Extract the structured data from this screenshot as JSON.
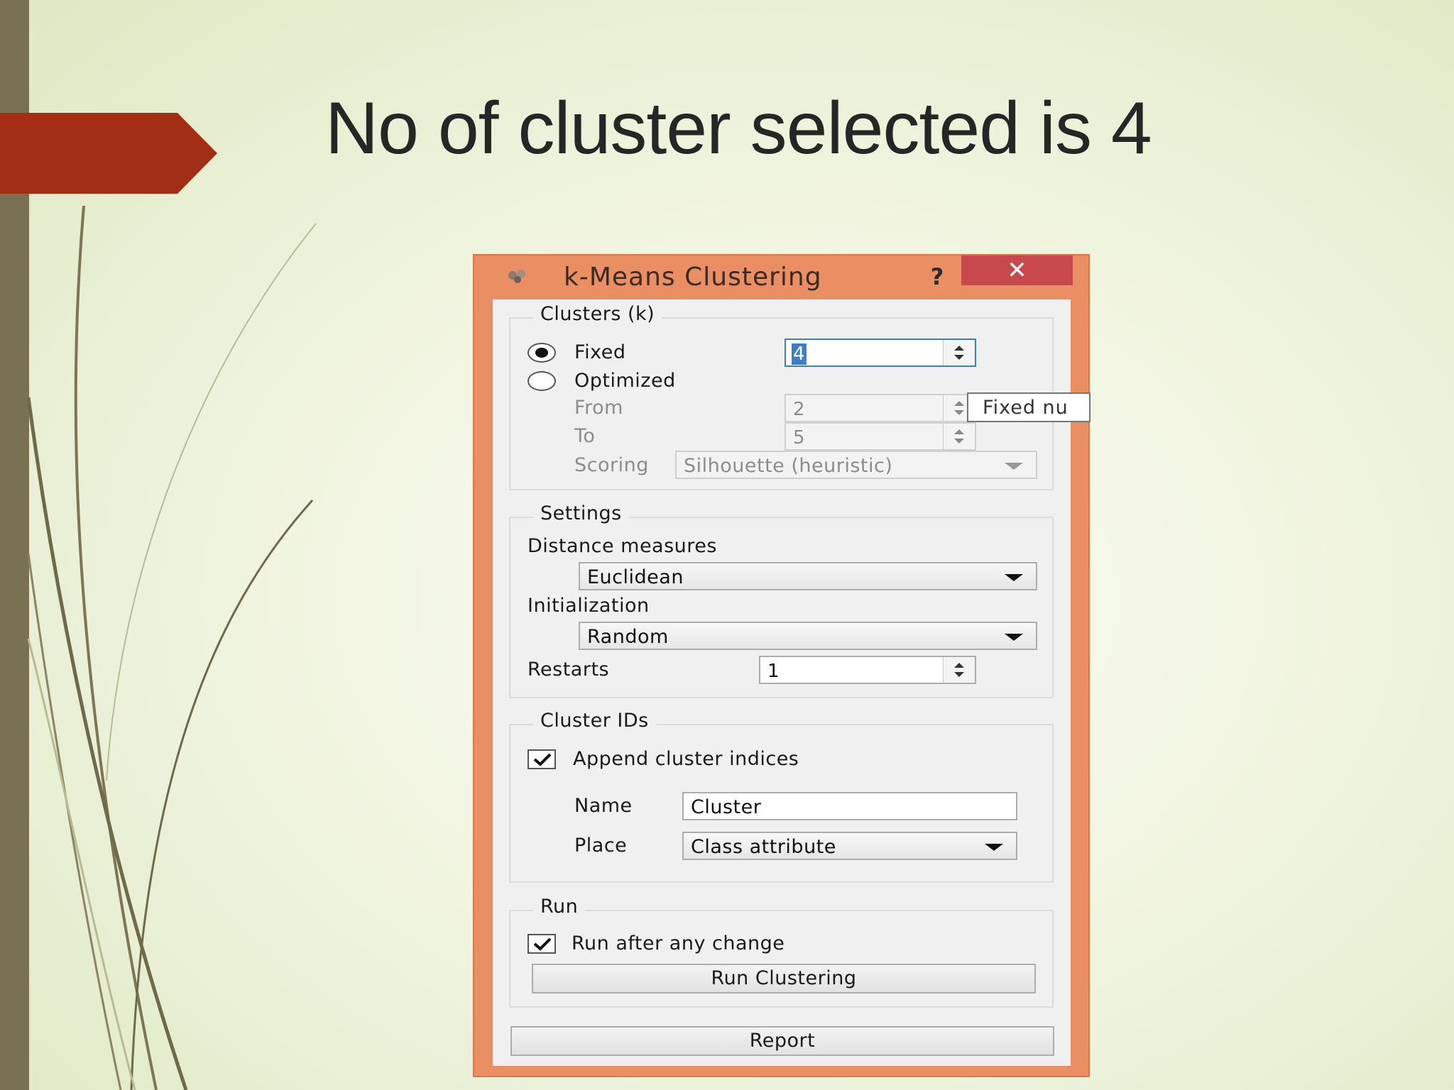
{
  "slide": {
    "title": "No of cluster selected is 4",
    "colors": {
      "bar": "#7a7052",
      "arrow": "#a32e16",
      "dialog_frame": "#e98f63",
      "close_button": "#c7484d",
      "selection": "#3c7fc6"
    }
  },
  "dialog": {
    "title": "k-Means Clustering",
    "help_label": "?",
    "close_label": "✕",
    "clusters": {
      "title": "Clusters (k)",
      "fixed_label": "Fixed",
      "fixed_value": "4",
      "optimized_label": "Optimized",
      "from_label": "From",
      "from_value": "2",
      "to_label": "To",
      "to_value": "5",
      "scoring_label": "Scoring",
      "scoring_value": "Silhouette (heuristic)",
      "selected_mode": "Fixed"
    },
    "settings": {
      "title": "Settings",
      "distance_label": "Distance measures",
      "distance_value": "Euclidean",
      "init_label": "Initialization",
      "init_value": "Random",
      "restarts_label": "Restarts",
      "restarts_value": "1"
    },
    "cluster_ids": {
      "title": "Cluster IDs",
      "append_label": "Append cluster indices",
      "append_checked": true,
      "name_label": "Name",
      "name_value": "Cluster",
      "place_label": "Place",
      "place_value": "Class attribute"
    },
    "run": {
      "title": "Run",
      "auto_label": "Run after any change",
      "auto_checked": true,
      "run_button": "Run Clustering"
    },
    "report_button": "Report",
    "tooltip": "Fixed nu"
  }
}
